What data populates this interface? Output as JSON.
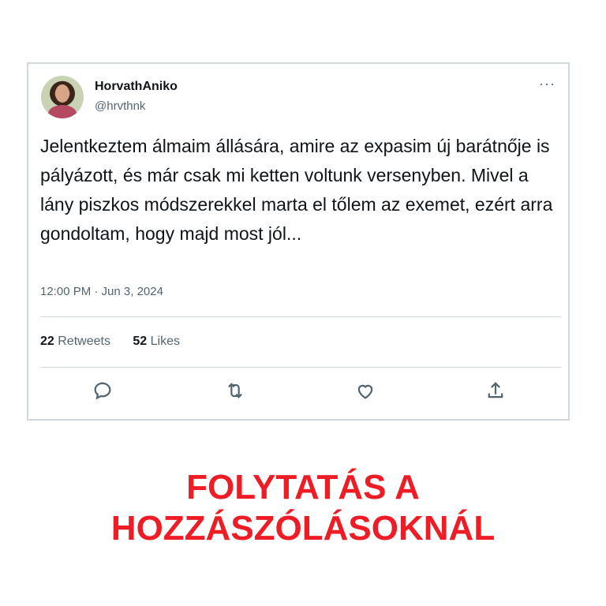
{
  "tweet": {
    "display_name": "HorvathAniko",
    "handle": "@hrvthnk",
    "text": "Jelentkeztem álmaim állására, amire az expasim új barátnője is pályázott, és már csak mi ketten voltunk versenyben. Mivel a lány piszkos módszerekkel marta el tőlem az exemet, ezért arra gondoltam, hogy majd most jól...",
    "timestamp": "12:00 PM · Jun 3, 2024",
    "retweets_count": "22",
    "retweets_label": "Retweets",
    "likes_count": "52",
    "likes_label": "Likes",
    "more_icon": "···"
  },
  "icons": [
    "reply-icon",
    "retweet-icon",
    "like-icon",
    "share-icon",
    "more-icon"
  ],
  "cta": {
    "line1": "FOLYTATÁS A",
    "line2": "HOZZÁSZÓLÁSOKNÁL",
    "color": "#ee1c25"
  }
}
